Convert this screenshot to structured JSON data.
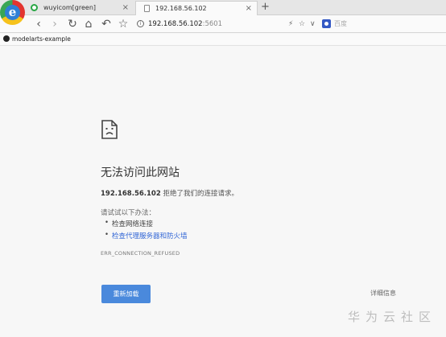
{
  "browser": {
    "logo_letter": "e",
    "tabs": [
      {
        "title": "wuyicom[green]",
        "close": "×"
      },
      {
        "title": "192.168.56.102",
        "close": "×"
      }
    ],
    "new_tab": "+",
    "nav": {
      "back": "‹",
      "forward": "›",
      "reload": "↻",
      "home": "⌂",
      "undo": "↶",
      "star": "☆"
    },
    "address": {
      "host": "192.168.56.102",
      "port": ":5601",
      "info": "i"
    },
    "toolbar_right": {
      "bolt": "⚡",
      "star": "☆",
      "chevron": "∨"
    },
    "search_placeholder": "百度",
    "bookmark": "modelarts-example"
  },
  "error": {
    "title": "无法访问此网站",
    "host": "192.168.56.102",
    "message": " 拒绝了我们的连接请求。",
    "try_heading": "请试试以下办法：",
    "suggestions": [
      "检查网络连接",
      "检查代理服务器和防火墙"
    ],
    "code": "ERR_CONNECTION_REFUSED",
    "reload_label": "重新加载",
    "details_label": "详细信息"
  },
  "watermark": "华为云社区",
  "colors": {
    "accent": "#4a89dc",
    "link": "#3367d6",
    "page_bg": "#f7f7f7"
  }
}
